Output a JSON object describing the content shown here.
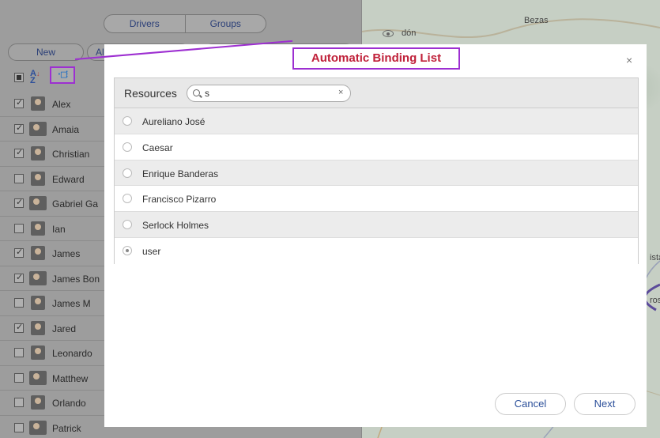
{
  "left_panel": {
    "tabs": [
      "Drivers",
      "Groups"
    ],
    "new_label": "New",
    "all_label": "Al",
    "sort_icon": "sort-az-icon",
    "bind_icon": "automatic-binding-icon",
    "drivers": [
      {
        "name": "Alex",
        "checked": true
      },
      {
        "name": "Amaia",
        "checked": true
      },
      {
        "name": "Christian",
        "checked": true
      },
      {
        "name": "Edward",
        "checked": false
      },
      {
        "name": "Gabriel Ga",
        "checked": true
      },
      {
        "name": "Ian",
        "checked": false
      },
      {
        "name": "James",
        "checked": true
      },
      {
        "name": "James Bon",
        "checked": true
      },
      {
        "name": "James M",
        "checked": false
      },
      {
        "name": "Jared",
        "checked": true
      },
      {
        "name": "Leonardo",
        "checked": false
      },
      {
        "name": "Matthew",
        "checked": false
      },
      {
        "name": "Orlando",
        "checked": false
      },
      {
        "name": "Patrick",
        "checked": false
      }
    ]
  },
  "map": {
    "labels": [
      "Bezas",
      "dón",
      "ista",
      "ros"
    ]
  },
  "callout": {
    "text": "Automatic Binding List",
    "color": "#9d2fd1"
  },
  "modal": {
    "close_icon": "close-icon",
    "resources_label": "Resources",
    "search": {
      "value": "s",
      "icon": "search-icon",
      "clear_icon": "clear-icon"
    },
    "resources": [
      {
        "name": "Aureliano José",
        "selected": false
      },
      {
        "name": "Caesar",
        "selected": false
      },
      {
        "name": "Enrique Banderas",
        "selected": false
      },
      {
        "name": "Francisco Pizarro",
        "selected": false
      },
      {
        "name": "Serlock Holmes",
        "selected": false
      },
      {
        "name": "user",
        "selected": true
      }
    ],
    "cancel_label": "Cancel",
    "next_label": "Next"
  }
}
